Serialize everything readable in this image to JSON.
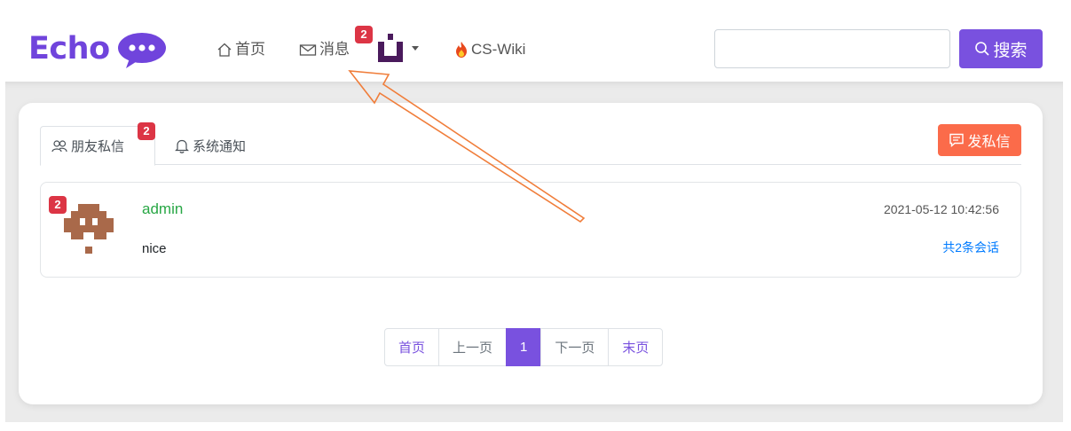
{
  "header": {
    "logo_text": "Echo",
    "nav": {
      "home_label": "首页",
      "messages_label": "消息",
      "messages_badge": "2",
      "wiki_label": "CS-Wiki"
    },
    "search": {
      "value": "",
      "placeholder": "",
      "button_label": "搜索"
    }
  },
  "letters_panel": {
    "tabs": [
      {
        "label": "朋友私信",
        "badge": "2",
        "active": true
      },
      {
        "label": "系统通知",
        "active": false
      }
    ],
    "send_button_label": "发私信",
    "items": [
      {
        "badge": "2",
        "username": "admin",
        "time": "2021-05-12 10:42:56",
        "content": "nice",
        "count_text": "共2条会话"
      }
    ],
    "pagination": [
      {
        "label": "首页",
        "state": "link"
      },
      {
        "label": "上一页",
        "state": "plain"
      },
      {
        "label": "1",
        "state": "active"
      },
      {
        "label": "下一页",
        "state": "plain"
      },
      {
        "label": "末页",
        "state": "link"
      }
    ]
  },
  "colors": {
    "brand": "#7951df",
    "danger_badge": "#dc3545",
    "send_button": "#fb6b4a",
    "username": "#28a745",
    "link": "#007bff",
    "annotation_arrow": "#f07d3a"
  },
  "icons": {
    "home": "home-icon",
    "messages": "envelope-icon",
    "wiki": "fire-icon",
    "search": "search-icon",
    "friends": "people-icon",
    "notice": "bell-icon",
    "send": "chat-icon"
  }
}
